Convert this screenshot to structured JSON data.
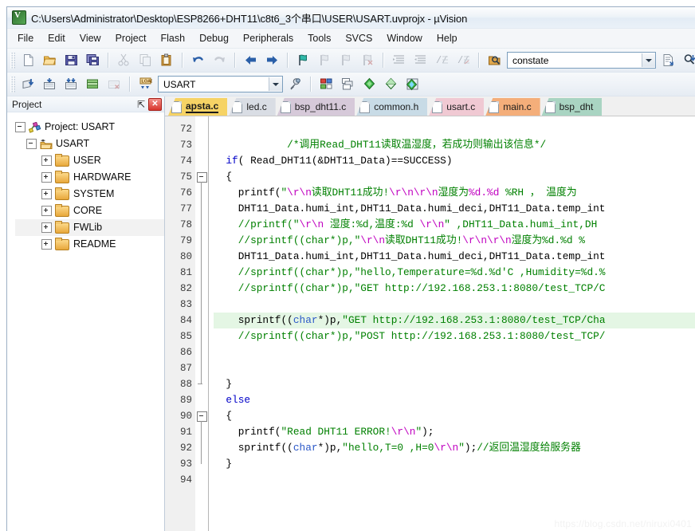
{
  "window": {
    "title": "C:\\Users\\Administrator\\Desktop\\ESP8266+DHT11\\c8t6_3个串口\\USER\\USART.uvprojx - µVision",
    "app_icon": "uvision-logo-icon"
  },
  "menubar": {
    "items": [
      {
        "label": "File"
      },
      {
        "label": "Edit"
      },
      {
        "label": "View"
      },
      {
        "label": "Project"
      },
      {
        "label": "Flash"
      },
      {
        "label": "Debug"
      },
      {
        "label": "Peripherals"
      },
      {
        "label": "Tools"
      },
      {
        "label": "SVCS"
      },
      {
        "label": "Window"
      },
      {
        "label": "Help"
      }
    ]
  },
  "toolbar_main": {
    "buttons": [
      {
        "name": "new-file-icon",
        "enabled": true
      },
      {
        "name": "open-file-icon",
        "enabled": true
      },
      {
        "name": "save-icon",
        "enabled": true
      },
      {
        "name": "save-all-icon",
        "enabled": true
      },
      {
        "name": "cut-icon",
        "enabled": false
      },
      {
        "name": "copy-icon",
        "enabled": false
      },
      {
        "name": "paste-icon",
        "enabled": true
      },
      {
        "name": "undo-icon",
        "enabled": true
      },
      {
        "name": "redo-icon",
        "enabled": false
      },
      {
        "name": "navigate-backward-icon",
        "enabled": true
      },
      {
        "name": "navigate-forward-icon",
        "enabled": true
      },
      {
        "name": "toggle-bookmark-icon",
        "enabled": true
      },
      {
        "name": "previous-bookmark-icon",
        "enabled": false
      },
      {
        "name": "next-bookmark-icon",
        "enabled": false
      },
      {
        "name": "clear-bookmarks-icon",
        "enabled": false
      },
      {
        "name": "indent-icon",
        "enabled": false
      },
      {
        "name": "outdent-icon",
        "enabled": false
      },
      {
        "name": "comment-block-icon",
        "enabled": false
      },
      {
        "name": "uncomment-block-icon",
        "enabled": false
      },
      {
        "name": "find-in-files-icon",
        "enabled": true
      }
    ],
    "find_combo": {
      "value": "constate",
      "placeholder": "Find"
    },
    "after_find_buttons": [
      {
        "name": "insert-file-icon",
        "enabled": true
      },
      {
        "name": "incremental-find-icon",
        "enabled": true
      },
      {
        "name": "browse-symbol-icon",
        "enabled": true
      }
    ]
  },
  "toolbar_build": {
    "buttons": [
      {
        "name": "translate-icon",
        "enabled": true
      },
      {
        "name": "build-icon",
        "enabled": true
      },
      {
        "name": "rebuild-icon",
        "enabled": true
      },
      {
        "name": "batch-build-icon",
        "enabled": true
      },
      {
        "name": "stop-build-icon",
        "enabled": false
      },
      {
        "name": "download-icon",
        "enabled": true
      }
    ],
    "target_combo": {
      "value": "USART",
      "placeholder": "Select Target"
    },
    "after_target_buttons": [
      {
        "name": "target-options-icon",
        "enabled": true
      },
      {
        "name": "manage-project-items-icon",
        "enabled": true
      },
      {
        "name": "manage-multi-project-icon",
        "enabled": true
      },
      {
        "name": "pack-installer-icon",
        "enabled": true
      },
      {
        "name": "manage-runtime-environment-icon",
        "enabled": true
      },
      {
        "name": "pack-manage-icon",
        "enabled": true
      }
    ]
  },
  "project_pane": {
    "title": "Project",
    "pin_glyph": "⇱",
    "close_glyph": "✕",
    "tree": [
      {
        "label": "Project: USART",
        "level": 0,
        "expander": "minus",
        "icon": "project-icon",
        "selected": false
      },
      {
        "label": "USART",
        "level": 1,
        "expander": "minus",
        "icon": "target-icon",
        "selected": false
      },
      {
        "label": "USER",
        "level": 2,
        "expander": "plus",
        "icon": "folder-icon",
        "selected": false
      },
      {
        "label": "HARDWARE",
        "level": 2,
        "expander": "plus",
        "icon": "folder-icon",
        "selected": false
      },
      {
        "label": "SYSTEM",
        "level": 2,
        "expander": "plus",
        "icon": "folder-icon",
        "selected": false
      },
      {
        "label": "CORE",
        "level": 2,
        "expander": "plus",
        "icon": "folder-icon",
        "selected": false
      },
      {
        "label": "FWLib",
        "level": 2,
        "expander": "plus",
        "icon": "folder-icon",
        "selected": true
      },
      {
        "label": "README",
        "level": 2,
        "expander": "plus",
        "icon": "folder-icon",
        "selected": false
      }
    ]
  },
  "editor": {
    "tabs": [
      {
        "label": "apsta.c",
        "active": true,
        "color": "#f6d365"
      },
      {
        "label": "led.c",
        "active": false,
        "color": "#d9dde4"
      },
      {
        "label": "bsp_dht11.c",
        "active": false,
        "color": "#d6c9d9"
      },
      {
        "label": "common.h",
        "active": false,
        "color": "#c8dbe6"
      },
      {
        "label": "usart.c",
        "active": false,
        "color": "#f0c9d3"
      },
      {
        "label": "main.c",
        "active": false,
        "color": "#f4ae7a"
      },
      {
        "label": "bsp_dht",
        "active": false,
        "color": "#a9d4c2"
      }
    ],
    "first_line_number": 72,
    "last_line_number": 94,
    "highlighted_line": 84,
    "fold_open_lines": [
      75,
      90
    ],
    "fold_end_lines": [
      88
    ],
    "lines": [
      {
        "n": 72,
        "tokens": []
      },
      {
        "n": 73,
        "tokens": [
          {
            "t": "            ",
            "c": "pln"
          },
          {
            "t": "/*调用Read_DHT11读取温湿度，若成功则输出该信息*/",
            "c": "cmt"
          }
        ]
      },
      {
        "n": 74,
        "tokens": [
          {
            "t": "  ",
            "c": "pln"
          },
          {
            "t": "if",
            "c": "kw"
          },
          {
            "t": "( Read_DHT11(&DHT11_Data)==SUCCESS)",
            "c": "pln"
          }
        ]
      },
      {
        "n": 75,
        "tokens": [
          {
            "t": "  {",
            "c": "pln"
          }
        ]
      },
      {
        "n": 76,
        "tokens": [
          {
            "t": "    printf(",
            "c": "pln"
          },
          {
            "t": "\"",
            "c": "str"
          },
          {
            "t": "\\r\\n",
            "c": "esc"
          },
          {
            "t": "读取DHT11成功!",
            "c": "str"
          },
          {
            "t": "\\r\\n\\r\\n",
            "c": "esc"
          },
          {
            "t": "湿度为",
            "c": "str"
          },
          {
            "t": "%d.%d",
            "c": "esc"
          },
          {
            "t": " %RH ， 温度为",
            "c": "str"
          }
        ]
      },
      {
        "n": 77,
        "tokens": [
          {
            "t": "    DHT11_Data.humi_int,DHT11_Data.humi_deci,DHT11_Data.temp_int",
            "c": "pln"
          }
        ]
      },
      {
        "n": 78,
        "tokens": [
          {
            "t": "    //printf(\"",
            "c": "cmt"
          },
          {
            "t": "\\r\\n",
            "c": "esc"
          },
          {
            "t": " 湿度:%d,温度:%d ",
            "c": "cmt"
          },
          {
            "t": "\\r\\n",
            "c": "esc"
          },
          {
            "t": "\" ,DHT11_Data.humi_int,DH",
            "c": "cmt"
          }
        ]
      },
      {
        "n": 79,
        "tokens": [
          {
            "t": "    //sprintf((char*)p,\"",
            "c": "cmt"
          },
          {
            "t": "\\r\\n",
            "c": "esc"
          },
          {
            "t": "读取DHT11成功!",
            "c": "cmt"
          },
          {
            "t": "\\r\\n\\r\\n",
            "c": "esc"
          },
          {
            "t": "湿度为%d.%d %",
            "c": "cmt"
          }
        ]
      },
      {
        "n": 80,
        "tokens": [
          {
            "t": "    DHT11_Data.humi_int,DHT11_Data.humi_deci,DHT11_Data.temp_int",
            "c": "pln"
          }
        ]
      },
      {
        "n": 81,
        "tokens": [
          {
            "t": "    //sprintf((char*)p,\"hello,Temperature=%d.%d'C ,Humidity=%d.%",
            "c": "cmt"
          }
        ]
      },
      {
        "n": 82,
        "tokens": [
          {
            "t": "    //sprintf((char*)p,\"GET http://192.168.253.1:8080/test_TCP/C",
            "c": "cmt"
          }
        ]
      },
      {
        "n": 83,
        "tokens": []
      },
      {
        "n": 84,
        "tokens": [
          {
            "t": "    sprintf((",
            "c": "pln"
          },
          {
            "t": "char",
            "c": "type"
          },
          {
            "t": "*)p,",
            "c": "pln"
          },
          {
            "t": "\"GET http://192.168.253.1:8080/test_TCP/Cha",
            "c": "str"
          }
        ]
      },
      {
        "n": 85,
        "tokens": [
          {
            "t": "    //sprintf((char*)p,\"POST http://192.168.253.1:8080/test_TCP/",
            "c": "cmt"
          }
        ]
      },
      {
        "n": 86,
        "tokens": []
      },
      {
        "n": 87,
        "tokens": []
      },
      {
        "n": 88,
        "tokens": [
          {
            "t": "  }",
            "c": "pln"
          }
        ]
      },
      {
        "n": 89,
        "tokens": [
          {
            "t": "  ",
            "c": "pln"
          },
          {
            "t": "else",
            "c": "kw"
          }
        ]
      },
      {
        "n": 90,
        "tokens": [
          {
            "t": "  {",
            "c": "pln"
          }
        ]
      },
      {
        "n": 91,
        "tokens": [
          {
            "t": "    printf(",
            "c": "pln"
          },
          {
            "t": "\"Read DHT11 ERROR!",
            "c": "str"
          },
          {
            "t": "\\r\\n",
            "c": "esc"
          },
          {
            "t": "\"",
            "c": "str"
          },
          {
            "t": ");",
            "c": "pln"
          }
        ]
      },
      {
        "n": 92,
        "tokens": [
          {
            "t": "    sprintf((",
            "c": "pln"
          },
          {
            "t": "char",
            "c": "type"
          },
          {
            "t": "*)p,",
            "c": "pln"
          },
          {
            "t": "\"hello,T=0 ,H=0",
            "c": "str"
          },
          {
            "t": "\\r\\n",
            "c": "esc"
          },
          {
            "t": "\"",
            "c": "str"
          },
          {
            "t": ");",
            "c": "pln"
          },
          {
            "t": "//返回温湿度给服务器",
            "c": "cmt"
          }
        ]
      },
      {
        "n": 93,
        "tokens": [
          {
            "t": "  }",
            "c": "pln"
          }
        ]
      },
      {
        "n": 94,
        "tokens": []
      }
    ]
  },
  "watermark": {
    "text": "https://blog.csdn.net/niruxi0401"
  },
  "colors": {
    "active_tab": "#f6d365",
    "highlight_line": "#e4f6e4",
    "keyword": "#0000c8",
    "string": "#008000",
    "comment": "#008000",
    "escape": "#c000c0",
    "type": "#2b58c8"
  }
}
